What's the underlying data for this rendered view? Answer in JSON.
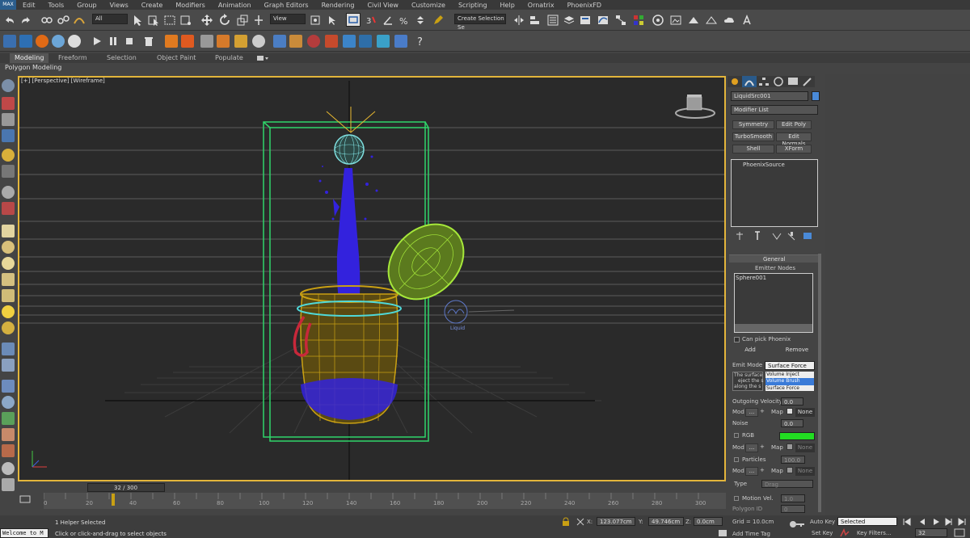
{
  "menu": {
    "logo": "MAX",
    "items": [
      "Edit",
      "Tools",
      "Group",
      "Views",
      "Create",
      "Modifiers",
      "Animation",
      "Graph Editors",
      "Rendering",
      "Civil View",
      "Customize",
      "Scripting",
      "Help",
      "Ornatrix",
      "PhoenixFD"
    ]
  },
  "toolbar": {
    "filter_value": "All",
    "view_value": "View",
    "selection_set_placeholder": "Create Selection Se"
  },
  "ribbon": {
    "tabs": [
      "Modeling",
      "Freeform",
      "Selection",
      "Object Paint",
      "Populate"
    ],
    "active_tab": "Modeling",
    "subtitle": "Polygon Modeling"
  },
  "viewport": {
    "label": "[+] [Perspective] [Wireframe]",
    "helper_label": "Liquid"
  },
  "command_panel": {
    "object_name": "LiquidSrc001",
    "modifier_list": "Modifier List",
    "modifier_buttons": [
      "Symmetry",
      "Edit Poly",
      "TurboSmooth",
      "Edit Normals",
      "Shell",
      "XForm"
    ],
    "stack_item": "PhoenixSource",
    "general_title": "General",
    "emitter_nodes_label": "Emitter Nodes",
    "emitter_item": "Sphere001",
    "can_pick_label": "Can pick Phoenix",
    "add_label": "Add",
    "remove_label": "Remove",
    "emit_mode_label": "Emit Mode",
    "emit_mode_value": "Surface Force",
    "emit_options": [
      "Volume Inject",
      "Volume Brush",
      "Surface Force"
    ],
    "desc_text": "The surface",
    "desc_text2": "eject the s",
    "desc_text3": "along the s",
    "outgoing_velocity_label": "Outgoing Velocity",
    "outgoing_velocity_value": "0.0",
    "mod_label": "Mod",
    "mod_value": "...",
    "map_label": "Map",
    "none_label": "None",
    "noise_label": "Noise",
    "noise_value": "0.0",
    "rgb_label": "RGB",
    "particles_label": "Particles",
    "particles_value": "100.0",
    "type_label": "Type",
    "type_value": "Drag",
    "motion_vel_label": "Motion Vel.",
    "motion_vel_value": "1.0",
    "polygon_id_label": "Polygon ID",
    "polygon_id_value": "0",
    "rgb_color": "#22dd22"
  },
  "timeline": {
    "frame_label": "32 / 300",
    "ticks": [
      "0",
      "20",
      "40",
      "60",
      "80",
      "100",
      "120",
      "140",
      "160",
      "180",
      "200",
      "220",
      "240",
      "260",
      "280",
      "300"
    ]
  },
  "status": {
    "console": "Welcome to M",
    "selected": "1 Helper Selected",
    "prompt": "Click or click-and-drag to select objects",
    "x_label": "X:",
    "x_value": "123.077cm",
    "y_label": "Y:",
    "y_value": "49.746cm",
    "z_label": "Z:",
    "z_value": "0.0cm",
    "grid": "Grid = 10.0cm",
    "add_time_tag": "Add Time Tag",
    "auto_key": "Auto Key",
    "set_key": "Set Key",
    "key_mode": "Selected",
    "key_filters": "Key Filters...",
    "current_frame": "32"
  },
  "colors": {
    "viewport_border": "#e3b53b",
    "container_box": "#2fd46a",
    "jar": "#c9a013",
    "liquid": "#3322dd",
    "lid": "#a6e83a"
  }
}
